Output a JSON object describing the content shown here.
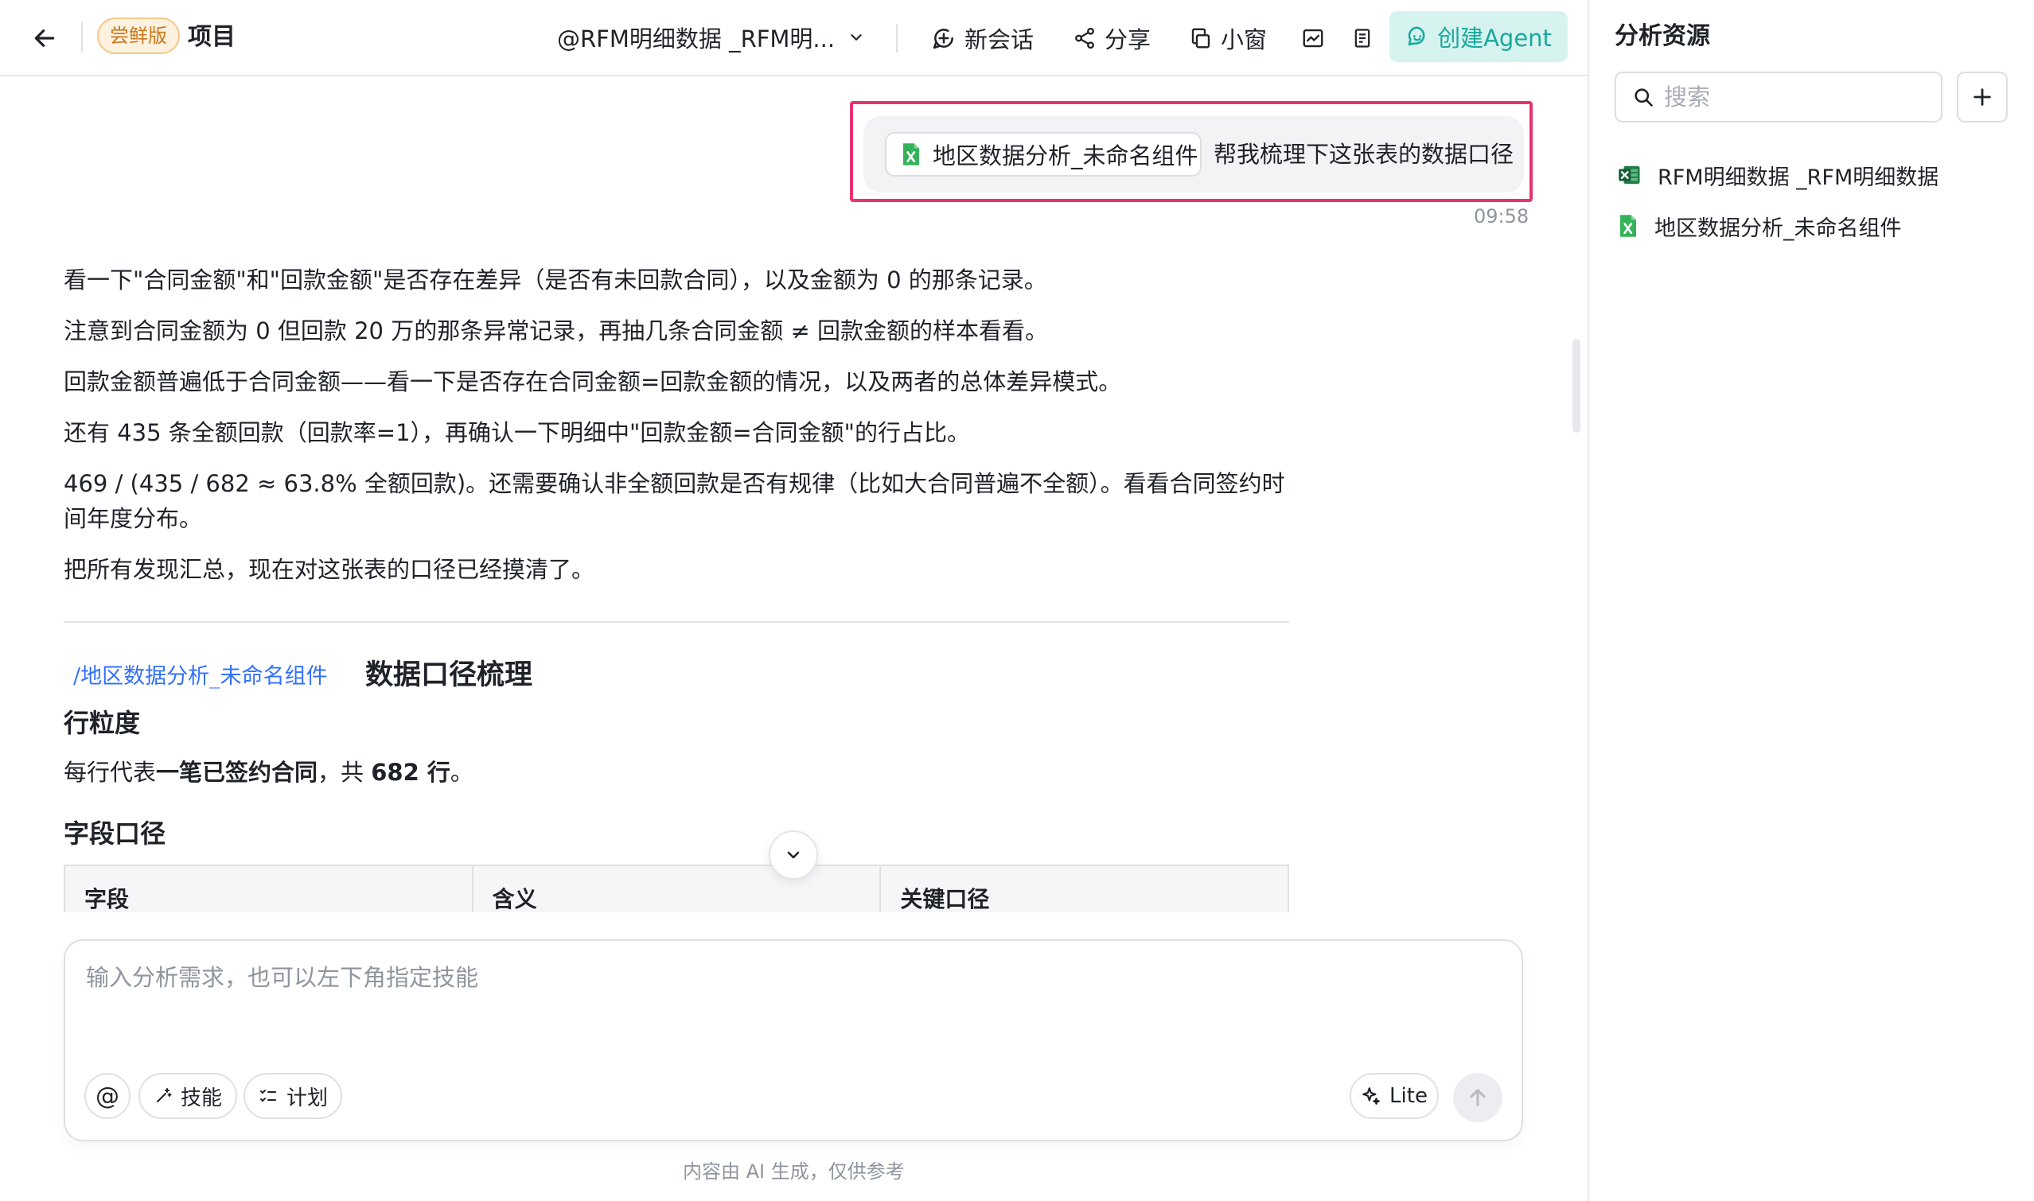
{
  "header": {
    "badge": "尝鲜版",
    "project": "项目",
    "dataset": "@RFM明细数据 _RFM明...",
    "new_chat": "新会话",
    "share": "分享",
    "small_window": "小窗",
    "create_agent": "创建Agent"
  },
  "chat": {
    "question": {
      "file_chip": "地区数据分析_未命名组件",
      "text": "帮我梳理下这张表的数据口径",
      "time": "09:58"
    },
    "answer_paragraphs": [
      "看一下\"合同金额\"和\"回款金额\"是否存在差异（是否有未回款合同），以及金额为 0 的那条记录。",
      "注意到合同金额为 0 但回款 20 万的那条异常记录，再抽几条合同金额 ≠ 回款金额的样本看看。",
      "回款金额普遍低于合同金额——看一下是否存在合同金额=回款金额的情况，以及两者的总体差异模式。",
      "还有 435 条全额回款（回款率=1），再确认一下明细中\"回款金额=合同金额\"的行占比。",
      "469 / (435 / 682 ≈ 63.8% 全额回款)。还需要确认非全额回款是否有规律（比如大合同普遍不全额）。看看合同签约时间年度分布。",
      "把所有发现汇总，现在对这张表的口径已经摸清了。"
    ],
    "report": {
      "link": "/地区数据分析_未命名组件",
      "title": "数据口径梳理",
      "section_row": "行粒度",
      "row_text_pre": "每行代表",
      "row_text_bold": "一笔已签约合同",
      "row_text_mid": "，共 ",
      "row_count": "682 行",
      "row_text_end": "。",
      "section_fields": "字段口径",
      "table_headers": [
        "字段",
        "含义",
        "关键口径"
      ]
    }
  },
  "composer": {
    "placeholder": "输入分析需求，也可以左下角指定技能",
    "at": "@",
    "skills": "技能",
    "plan": "计划",
    "mode": "Lite",
    "disclaimer": "内容由 AI 生成，仅供参考"
  },
  "sidebar": {
    "title": "分析资源",
    "search_placeholder": "搜索",
    "resources": [
      {
        "name": "RFM明细数据 _RFM明细数据",
        "icon": "excel-icon"
      },
      {
        "name": "地区数据分析_未命名组件",
        "icon": "spreadsheet-icon"
      }
    ]
  },
  "colors": {
    "accent_teal": "#19a89b",
    "highlight": "#e8336f",
    "link": "#3370ff",
    "badge": "#c9791c",
    "excel_green": "#1f7a45",
    "sheet_green": "#34b35a"
  }
}
